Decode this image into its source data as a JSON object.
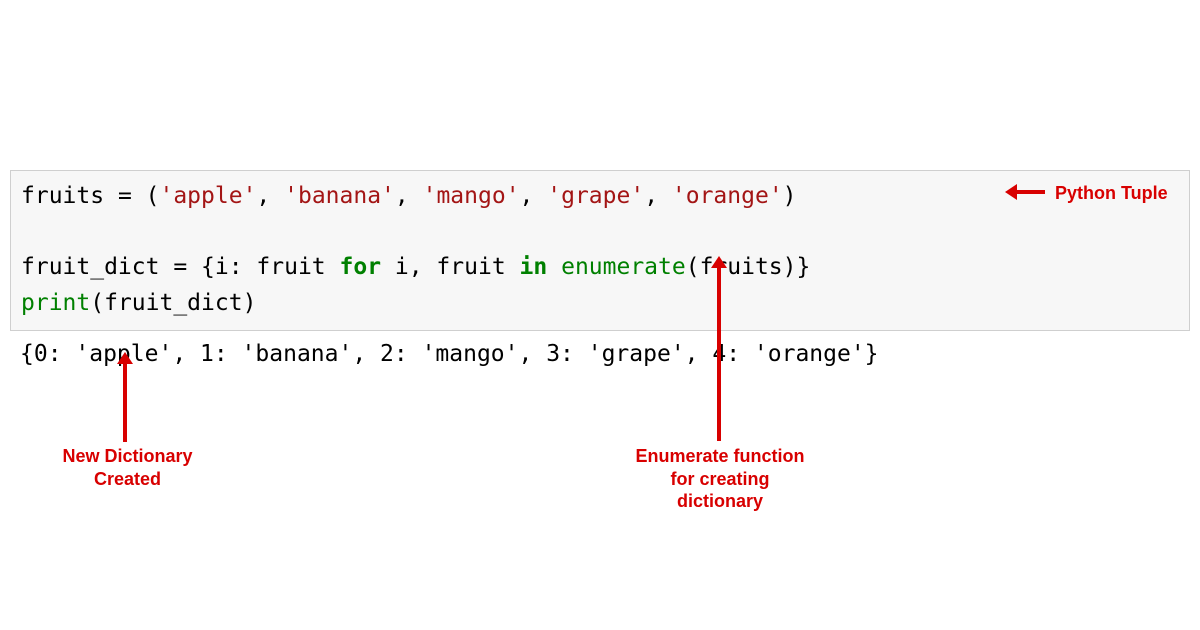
{
  "code": {
    "line1": {
      "var": "fruits",
      "eq": " = (",
      "s1": "'apple'",
      "c1": ", ",
      "s2": "'banana'",
      "c2": ", ",
      "s3": "'mango'",
      "c3": ", ",
      "s4": "'grape'",
      "c4": ", ",
      "s5": "'orange'",
      "close": ")"
    },
    "blank": " ",
    "line2": {
      "var": "fruit_dict",
      "eq": " = {i: fruit ",
      "for": "for",
      "mid": " i, fruit ",
      "in": "in",
      "sp": " ",
      "enum": "enumerate",
      "tail": "(fruits)}"
    },
    "line3": {
      "print": "print",
      "tail": "(fruit_dict)"
    }
  },
  "output": "{0: 'apple', 1: 'banana', 2: 'mango', 3: 'grape', 4: 'orange'}",
  "annotations": {
    "tuple": "Python Tuple",
    "newdict_l1": "New Dictionary",
    "newdict_l2": "Created",
    "enum_l1": "Enumerate function",
    "enum_l2": "for creating",
    "enum_l3": "dictionary"
  }
}
